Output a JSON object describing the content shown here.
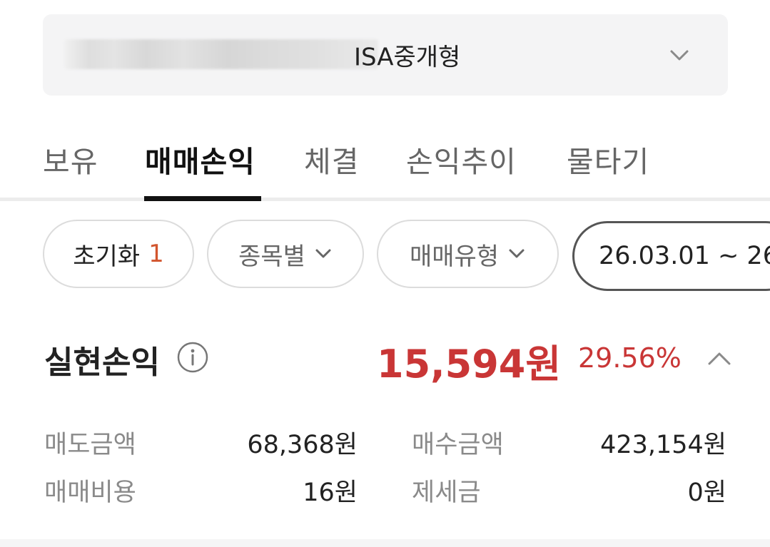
{
  "account": {
    "name": "ISA중개형"
  },
  "tabs": [
    {
      "label": "보유"
    },
    {
      "label": "매매손익"
    },
    {
      "label": "체결"
    },
    {
      "label": "손익추이"
    },
    {
      "label": "물타기"
    }
  ],
  "filters": {
    "reset_label": "초기화",
    "reset_count": "1",
    "by_stock_label": "종목별",
    "trade_type_label": "매매유형",
    "date_range": "26.03.01 ~ 26"
  },
  "summary": {
    "title": "실현손익",
    "amount": "15,594원",
    "rate": "29.56%"
  },
  "details": {
    "sell_amount_label": "매도금액",
    "sell_amount": "68,368원",
    "buy_amount_label": "매수금액",
    "buy_amount": "423,154원",
    "trade_cost_label": "매매비용",
    "trade_cost": "16원",
    "tax_label": "제세금",
    "tax": "0원"
  },
  "colors": {
    "profit": "#c93636",
    "count_accent": "#d2552e",
    "active_tab": "#111111"
  }
}
